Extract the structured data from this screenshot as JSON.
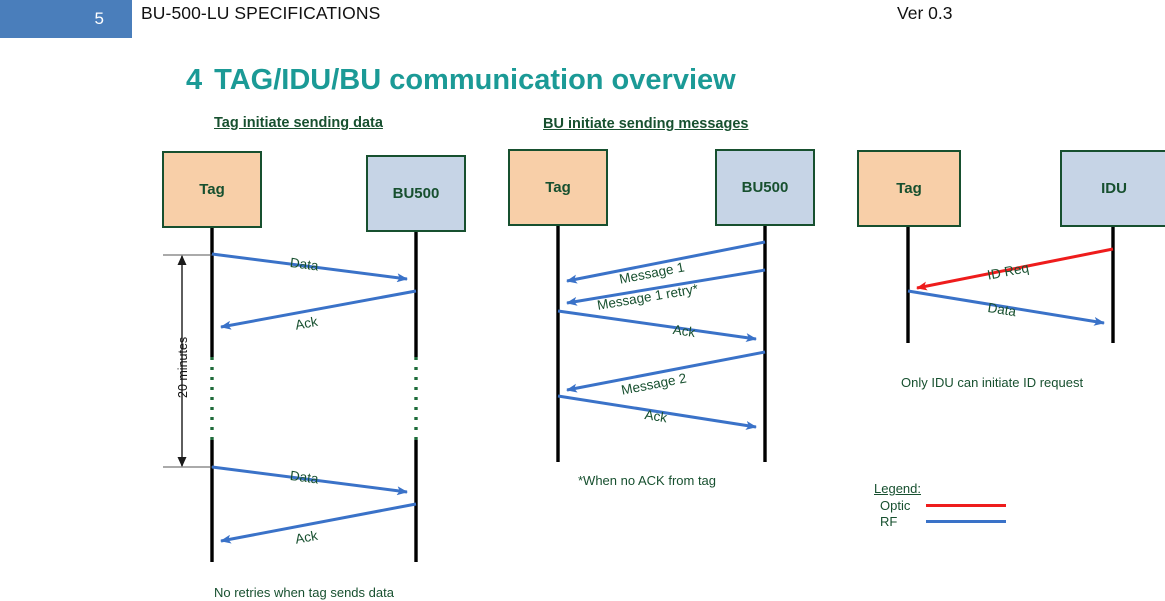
{
  "header": {
    "page_number": "5",
    "doc_title": "BU-500-LU SPECIFICATIONS",
    "version": "Ver 0.3",
    "badge_color": "#4A7EBB"
  },
  "section": {
    "number": "4",
    "title": "TAG/IDU/BU communication overview",
    "title_color": "#1B9A96"
  },
  "colors": {
    "tag_fill": "#F8CFA8",
    "unit_fill": "#C6D4E6",
    "node_border": "#17502F",
    "text_green": "#17502F",
    "rf_blue": "#3A72C8",
    "optic_red": "#EE1C1C",
    "lifeline_black": "#000000",
    "dotted_green": "#1E6B3A"
  },
  "diagrams": [
    {
      "id": "tag-initiate",
      "heading": "Tag initiate sending data",
      "nodes": [
        {
          "id": "tag",
          "label": "Tag",
          "type": "tag"
        },
        {
          "id": "bu500",
          "label": "BU500",
          "type": "unit"
        }
      ],
      "duration_label": "20 minutes",
      "messages": [
        {
          "label": "Data",
          "from": "tag",
          "to": "bu500",
          "link": "RF"
        },
        {
          "label": "Ack",
          "from": "bu500",
          "to": "tag",
          "link": "RF"
        },
        {
          "label": "Data",
          "from": "tag",
          "to": "bu500",
          "link": "RF"
        },
        {
          "label": "Ack",
          "from": "bu500",
          "to": "tag",
          "link": "RF"
        }
      ],
      "note": "No retries when tag sends data"
    },
    {
      "id": "bu-initiate",
      "heading": "BU initiate sending messages",
      "nodes": [
        {
          "id": "tag",
          "label": "Tag",
          "type": "tag"
        },
        {
          "id": "bu500",
          "label": "BU500",
          "type": "unit"
        }
      ],
      "messages": [
        {
          "label": "Message 1",
          "from": "bu500",
          "to": "tag",
          "link": "RF"
        },
        {
          "label": "Message 1 retry*",
          "from": "bu500",
          "to": "tag",
          "link": "RF"
        },
        {
          "label": "Ack",
          "from": "tag",
          "to": "bu500",
          "link": "RF"
        },
        {
          "label": "Message 2",
          "from": "bu500",
          "to": "tag",
          "link": "RF"
        },
        {
          "label": "Ack",
          "from": "tag",
          "to": "bu500",
          "link": "RF"
        }
      ],
      "note": "*When no ACK from tag"
    },
    {
      "id": "idu-initiate",
      "heading": "",
      "nodes": [
        {
          "id": "tag",
          "label": "Tag",
          "type": "tag"
        },
        {
          "id": "idu",
          "label": "IDU",
          "type": "unit"
        }
      ],
      "messages": [
        {
          "label": "ID Req",
          "from": "idu",
          "to": "tag",
          "link": "Optic"
        },
        {
          "label": "Data",
          "from": "tag",
          "to": "idu",
          "link": "RF"
        }
      ],
      "note": "Only IDU can initiate ID request"
    }
  ],
  "legend": {
    "title": "Legend:",
    "items": [
      {
        "label": "Optic",
        "color": "#EE1C1C"
      },
      {
        "label": "RF",
        "color": "#3A72C8"
      }
    ]
  },
  "labels": {
    "d1_data_1": "Data",
    "d1_ack_1": "Ack",
    "d1_data_2": "Data",
    "d1_ack_2": "Ack",
    "d2_msg1": "Message 1",
    "d2_msg1_retry": "Message 1 retry*",
    "d2_ack1": "Ack",
    "d2_msg2": "Message 2",
    "d2_ack2": "Ack",
    "d3_idreq": "ID Req",
    "d3_data": "Data"
  }
}
